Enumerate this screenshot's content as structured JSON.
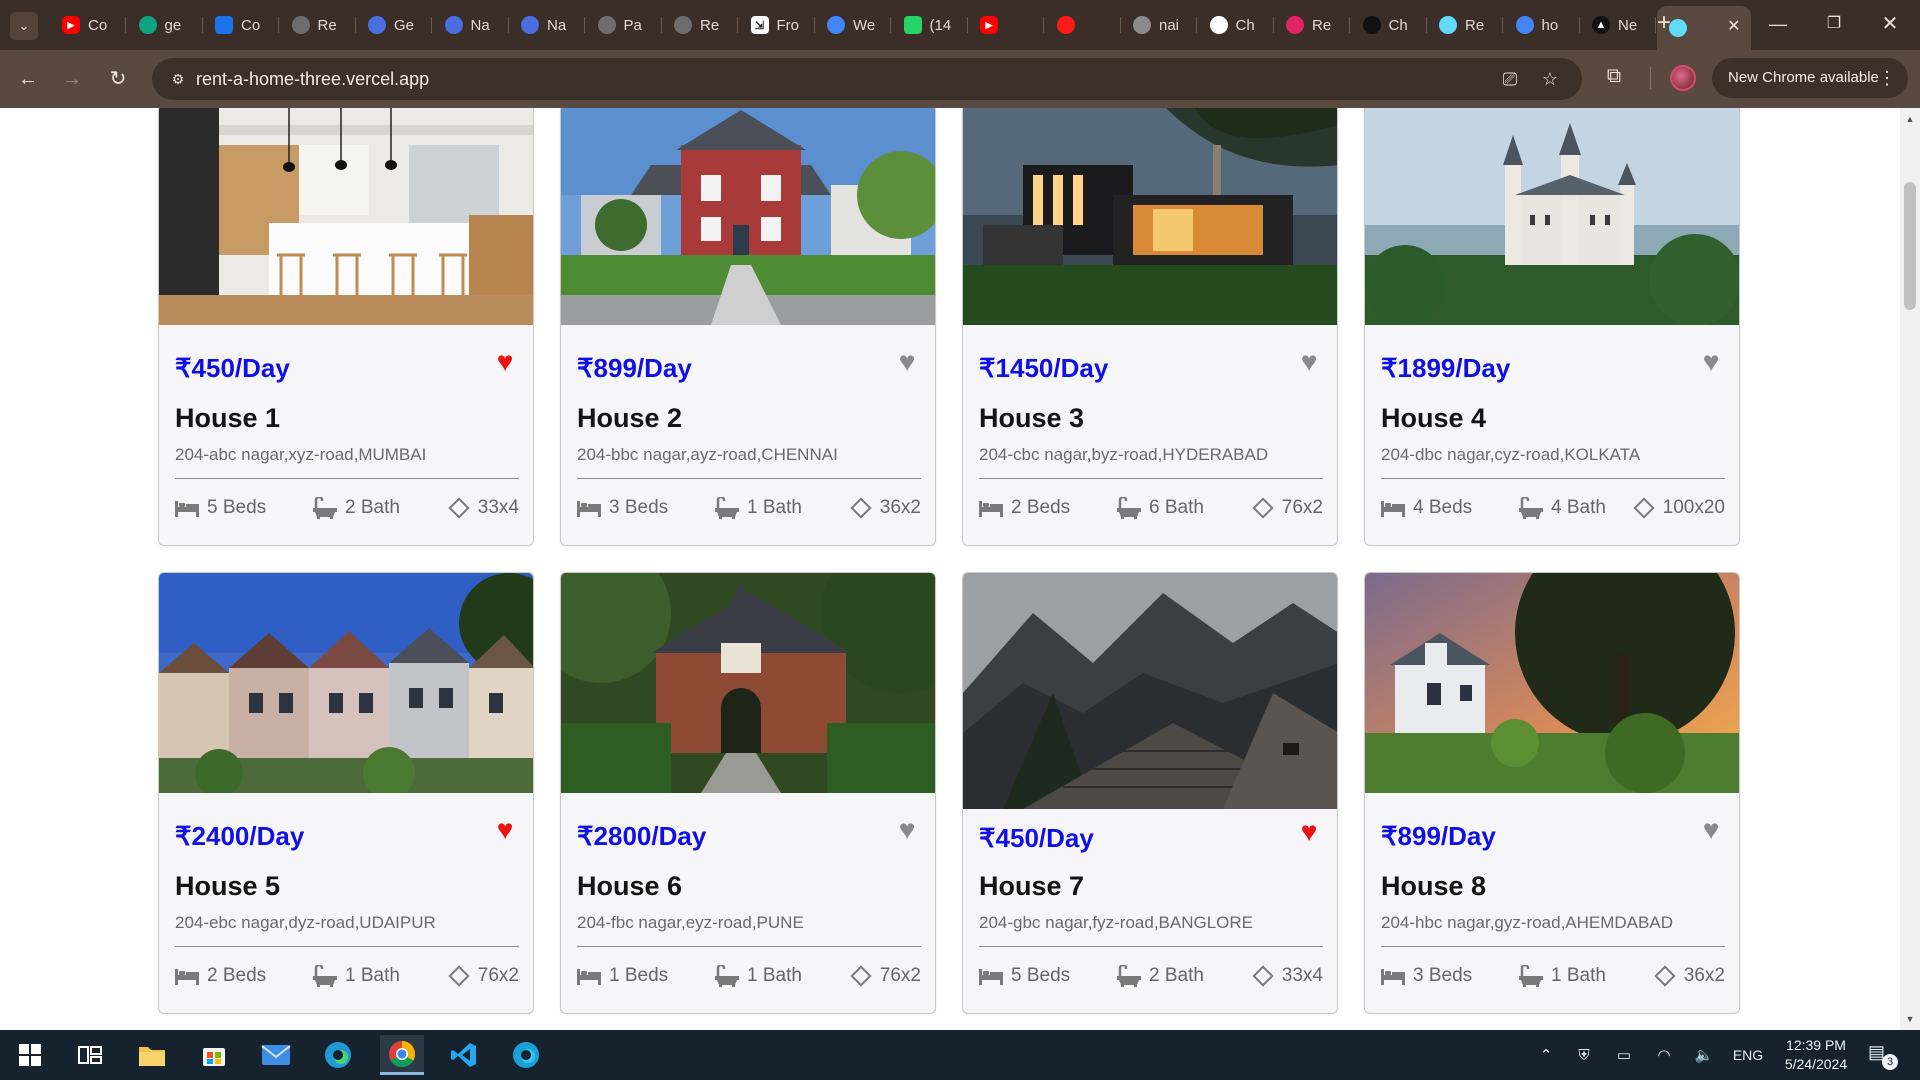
{
  "browser": {
    "tabs": [
      {
        "label": "Co",
        "favicon": "youtube-icon",
        "color": "#ff0000"
      },
      {
        "label": "ge",
        "favicon": "chatgpt-icon",
        "color": "#10a37f"
      },
      {
        "label": "Co",
        "favicon": "contacts-icon",
        "color": "#1a73e8"
      },
      {
        "label": "Re",
        "favicon": "globe-icon",
        "color": "#6d6d6d"
      },
      {
        "label": "Ge",
        "favicon": "gemini-icon",
        "color": "#4a6ee0"
      },
      {
        "label": "Na",
        "favicon": "gemini-icon",
        "color": "#4a6ee0"
      },
      {
        "label": "Na",
        "favicon": "gemini-icon",
        "color": "#4a6ee0"
      },
      {
        "label": "Pa",
        "favicon": "globe-icon",
        "color": "#6d6d6d"
      },
      {
        "label": "Re",
        "favicon": "globe-icon",
        "color": "#6d6d6d"
      },
      {
        "label": "Fro",
        "favicon": "frontend-mentor-icon",
        "color": "#ffffff"
      },
      {
        "label": "We",
        "favicon": "chrome-icon",
        "color": "#4285f4"
      },
      {
        "label": "(14",
        "favicon": "whatsapp-icon",
        "color": "#25d366"
      },
      {
        "label": "",
        "favicon": "youtube-icon",
        "color": "#ff0000"
      },
      {
        "label": "",
        "favicon": "record-icon",
        "color": "#ff1a1a"
      },
      {
        "label": "nai",
        "favicon": "github-icon",
        "color": "#8a8a8a"
      },
      {
        "label": "Ch",
        "favicon": "chatgpt-icon",
        "color": "#ffffff"
      },
      {
        "label": "Re",
        "favicon": "react-icon",
        "color": "#e0245e"
      },
      {
        "label": "Ch",
        "favicon": "chatgpt-icon",
        "color": "#111111"
      },
      {
        "label": "Re",
        "favicon": "react-icon",
        "color": "#61dafb"
      },
      {
        "label": "ho",
        "favicon": "google-icon",
        "color": "#4285f4"
      },
      {
        "label": "Ne",
        "favicon": "vercel-icon",
        "color": "#ffffff"
      },
      {
        "label": "",
        "favicon": "react-icon",
        "color": "#61dafb",
        "active": true
      }
    ],
    "url": "rent-a-home-three.vercel.app",
    "update_label": "New Chrome available"
  },
  "listings": [
    {
      "price": "₹450/Day",
      "title": "House 1",
      "address": "204-abc nagar,xyz-road,MUMBAI",
      "beds": "5 Beds",
      "bath": "2 Bath",
      "area": "33x4",
      "liked": true,
      "photo": "kitchen"
    },
    {
      "price": "₹899/Day",
      "title": "House 2",
      "address": "204-bbc nagar,ayz-road,CHENNAI",
      "beds": "3 Beds",
      "bath": "1 Bath",
      "area": "36x2",
      "liked": false,
      "photo": "red-house"
    },
    {
      "price": "₹1450/Day",
      "title": "House 3",
      "address": "204-cbc nagar,byz-road,HYDERABAD",
      "beds": "2 Beds",
      "bath": "6 Bath",
      "area": "76x2",
      "liked": false,
      "photo": "modern-house"
    },
    {
      "price": "₹1899/Day",
      "title": "House 4",
      "address": "204-dbc nagar,cyz-road,KOLKATA",
      "beds": "4 Beds",
      "bath": "4 Bath",
      "area": "100x20",
      "liked": false,
      "photo": "castle"
    },
    {
      "price": "₹2400/Day",
      "title": "House 5",
      "address": "204-ebc nagar,dyz-road,UDAIPUR",
      "beds": "2 Beds",
      "bath": "1 Bath",
      "area": "76x2",
      "liked": true,
      "photo": "painted-ladies"
    },
    {
      "price": "₹2800/Day",
      "title": "House 6",
      "address": "204-fbc nagar,eyz-road,PUNE",
      "beds": "1 Beds",
      "bath": "1 Bath",
      "area": "76x2",
      "liked": false,
      "photo": "brick-gatehouse"
    },
    {
      "price": "₹450/Day",
      "title": "House 7",
      "address": "204-gbc nagar,fyz-road,BANGLORE",
      "beds": "5 Beds",
      "bath": "2 Bath",
      "area": "33x4",
      "liked": true,
      "photo": "mountain-cabin"
    },
    {
      "price": "₹899/Day",
      "title": "House 8",
      "address": "204-hbc nagar,gyz-road,AHEMDABAD",
      "beds": "3 Beds",
      "bath": "1 Bath",
      "area": "36x2",
      "liked": false,
      "photo": "white-cottage"
    }
  ],
  "taskbar": {
    "apps": [
      "windows-start-icon",
      "task-view-icon",
      "file-explorer-icon",
      "microsoft-store-icon",
      "mail-icon",
      "edge-icon",
      "chrome-icon",
      "vscode-icon",
      "edge-beta-icon"
    ],
    "language": "ENG",
    "time": "12:39 PM",
    "date": "5/24/2024",
    "notification_count": "3"
  },
  "colors": {
    "price": "#1010e6",
    "liked_heart": "#ee1111",
    "unliked_heart": "#8a8a8a",
    "chrome_frame": "#3b2e28",
    "chrome_toolbar": "#5a4940"
  }
}
